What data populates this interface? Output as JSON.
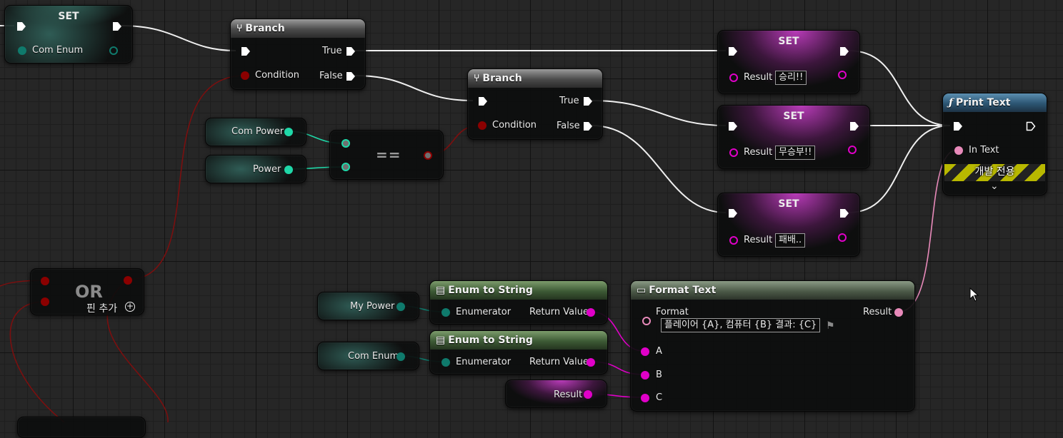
{
  "colors": {
    "exec": "#ffffff",
    "bool": "#8b0000",
    "enum": "#0f7a6c",
    "byte_int": "#1fd8a8",
    "text": "#e14fc0",
    "print_header": "#2c5572"
  },
  "nodes": {
    "set_com_enum": {
      "title": "SET",
      "pin": "Com Enum"
    },
    "branch1": {
      "title": "Branch",
      "true": "True",
      "false": "False",
      "condition": "Condition",
      "icon": "branch-icon"
    },
    "branch2": {
      "title": "Branch",
      "true": "True",
      "false": "False",
      "condition": "Condition",
      "icon": "branch-icon"
    },
    "var_com_power": {
      "label": "Com Power"
    },
    "var_power": {
      "label": "Power"
    },
    "equal": {
      "label": "=="
    },
    "or_node": {
      "label": "OR",
      "add_pin": "핀 추가",
      "add_icon": "plus-circle-icon"
    },
    "set_win": {
      "title": "SET",
      "pin": "Result",
      "value": "승리!!"
    },
    "set_draw": {
      "title": "SET",
      "pin": "Result",
      "value": "무승부!!"
    },
    "set_lose": {
      "title": "SET",
      "pin": "Result",
      "value": "패배.."
    },
    "print_text": {
      "title": "Print Text",
      "icon": "function-icon",
      "in_text": "In Text",
      "dev_only": "개발 전용",
      "expand_icon": "chevron-down-icon"
    },
    "var_my_power": {
      "label": "My Power"
    },
    "var_com_enum": {
      "label": "Com Enum"
    },
    "enum_to_string1": {
      "title": "Enum to String",
      "input": "Enumerator",
      "output": "Return Value",
      "icon": "document-icon"
    },
    "enum_to_string2": {
      "title": "Enum to String",
      "input": "Enumerator",
      "output": "Return Value",
      "icon": "document-icon"
    },
    "var_result": {
      "label": "Result"
    },
    "format_text": {
      "title": "Format Text",
      "icon": "format-icon",
      "format_label": "Format",
      "format_value": "플레이어 {A}, 컴퓨터 {B} 결과: {C}",
      "result": "Result",
      "a": "A",
      "b": "B",
      "c": "C",
      "flag_icon": "flag-icon"
    }
  }
}
